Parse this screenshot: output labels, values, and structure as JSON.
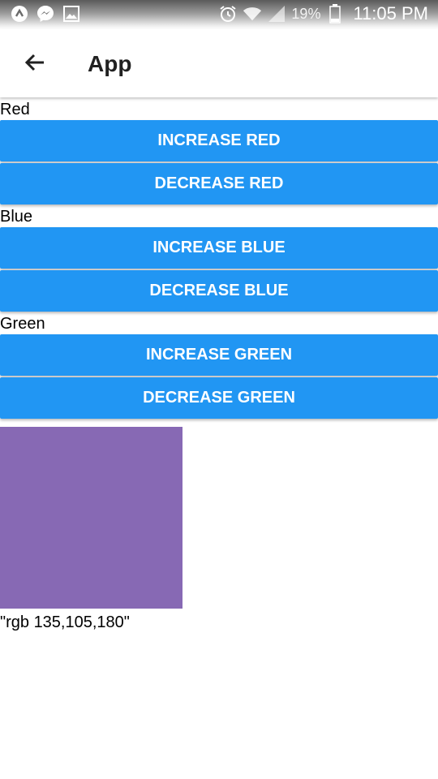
{
  "status_bar": {
    "battery_percent": "19%",
    "time": "11:05 PM",
    "icons": [
      "app-icon",
      "messenger-icon",
      "gallery-icon",
      "alarm-icon",
      "wifi-icon",
      "signal-icon",
      "battery-icon"
    ]
  },
  "app_bar": {
    "title": "App",
    "back_icon": "arrow-back-icon"
  },
  "controls": {
    "red": {
      "label": "Red",
      "increase": "INCREASE RED",
      "decrease": "DECREASE RED"
    },
    "blue": {
      "label": "Blue",
      "increase": "INCREASE BLUE",
      "decrease": "DECREASE BLUE"
    },
    "green": {
      "label": "Green",
      "increase": "INCREASE GREEN",
      "decrease": "DECREASE GREEN"
    }
  },
  "preview": {
    "color": "#8769b4",
    "rgb_text": "\"rgb 135,105,180\""
  },
  "colors": {
    "button": "#2196f3",
    "button_text": "#ffffff"
  }
}
